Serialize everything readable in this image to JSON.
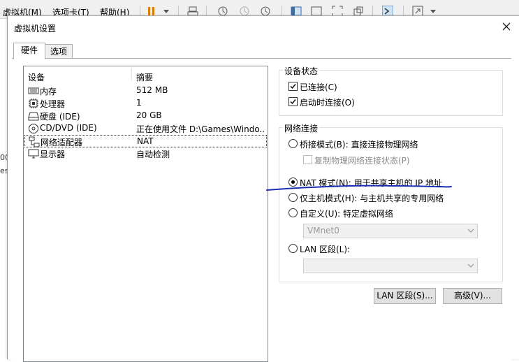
{
  "app_menu": {
    "items": [
      "虚拟机(M)",
      "选项卡(T)",
      "帮助(H)"
    ]
  },
  "dialog": {
    "title": "虚拟机设置",
    "tabs": [
      "硬件",
      "选项"
    ]
  },
  "device_list": {
    "headers": {
      "device": "设备",
      "summary": "摘要"
    },
    "rows": [
      {
        "name": "内存",
        "summary": "512 MB",
        "icon": "memory-icon"
      },
      {
        "name": "处理器",
        "summary": "1",
        "icon": "processor-icon"
      },
      {
        "name": "硬盘 (IDE)",
        "summary": "20 GB",
        "icon": "hard-disk-icon"
      },
      {
        "name": "CD/DVD (IDE)",
        "summary": "正在使用文件 D:\\Games\\Windo...",
        "icon": "cd-dvd-icon"
      },
      {
        "name": "网络适配器",
        "summary": "NAT",
        "icon": "network-adapter-icon"
      },
      {
        "name": "显示器",
        "summary": "自动检测",
        "icon": "display-icon"
      }
    ],
    "selected_index": 4
  },
  "device_status": {
    "legend": "设备状态",
    "connected": {
      "label": "已连接(C)",
      "checked": true
    },
    "connect_at_power_on": {
      "label": "启动时连接(O)",
      "checked": true
    }
  },
  "network": {
    "legend": "网络连接",
    "bridged": {
      "label": "桥接模式(B): 直接连接物理网络",
      "selected": false
    },
    "replicate": {
      "label": "复制物理网络连接状态(P)",
      "checked": false,
      "disabled": true
    },
    "nat": {
      "label": "NAT 模式(N): 用于共享主机的 IP 地址",
      "selected": true
    },
    "host_only": {
      "label": "仅主机模式(H): 与主机共享的专用网络",
      "selected": false
    },
    "custom": {
      "label": "自定义(U): 特定虚拟网络",
      "selected": false
    },
    "custom_combo_value": "VMnet0",
    "lan_segment": {
      "label": "LAN 区段(L):",
      "selected": false
    },
    "lan_combo_value": ""
  },
  "buttons": {
    "lan_segments": "LAN 区段(S)...",
    "advanced": "高级(V)..."
  },
  "background_text": {
    "left_fragment_1": "00",
    "left_fragment_2": "es"
  },
  "colors": {
    "annotation": "#1a2fb5",
    "tab_border": "#adadad"
  }
}
